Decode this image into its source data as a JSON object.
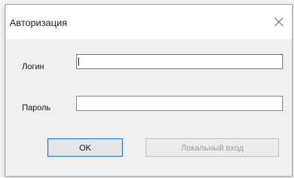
{
  "window": {
    "title": "Авторизация",
    "close_icon": "close-icon"
  },
  "form": {
    "login_label": "Логин",
    "login_value": "",
    "password_label": "Пароль",
    "password_value": ""
  },
  "buttons": {
    "ok_label": "OK",
    "local_login_label": "Локальный вход"
  },
  "colors": {
    "focus_border": "#2c7fd6",
    "disabled_text": "#9a9a9a"
  }
}
